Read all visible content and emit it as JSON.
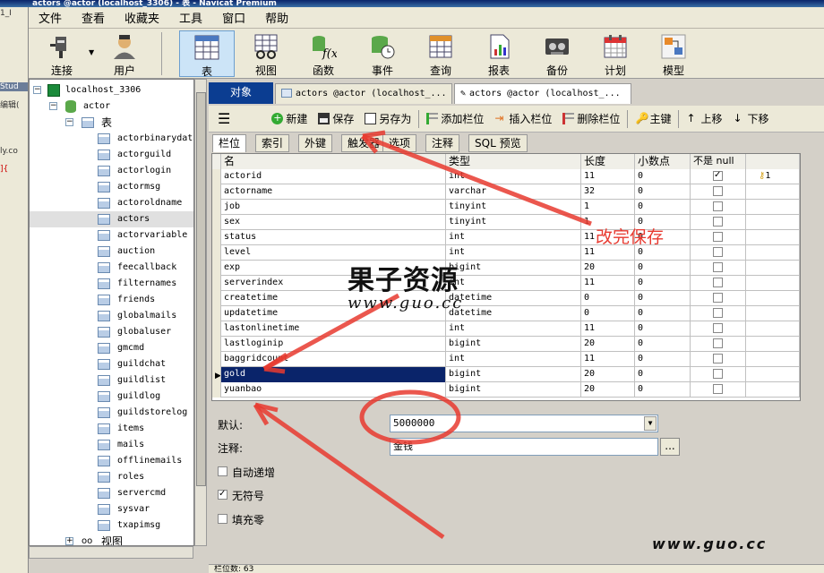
{
  "window": {
    "title": "actors @actor (localhost_3306) - 表 - Navicat Premium"
  },
  "left_strip": {
    "texts": [
      "1_I",
      "Stud",
      "编辑(",
      "ly.co",
      "]{"
    ]
  },
  "menu": [
    "文件",
    "查看",
    "收藏夹",
    "工具",
    "窗口",
    "帮助"
  ],
  "toolbar": [
    {
      "label": "连接",
      "icon": "plug-icon"
    },
    {
      "label": "用户",
      "icon": "user-icon"
    },
    {
      "label": "表",
      "icon": "table-icon"
    },
    {
      "label": "视图",
      "icon": "view-icon"
    },
    {
      "label": "函数",
      "icon": "function-icon"
    },
    {
      "label": "事件",
      "icon": "event-icon"
    },
    {
      "label": "查询",
      "icon": "query-icon"
    },
    {
      "label": "报表",
      "icon": "report-icon"
    },
    {
      "label": "备份",
      "icon": "backup-icon"
    },
    {
      "label": "计划",
      "icon": "schedule-icon"
    },
    {
      "label": "模型",
      "icon": "model-icon"
    }
  ],
  "tree": {
    "connection": "localhost_3306",
    "database": "actor",
    "tables_label": "表",
    "tables": [
      "actorbinarydata",
      "actorguild",
      "actorlogin",
      "actormsg",
      "actoroldname",
      "actors",
      "actorvariable",
      "auction",
      "feecallback",
      "filternames",
      "friends",
      "globalmails",
      "globaluser",
      "gmcmd",
      "guildchat",
      "guildlist",
      "guildlog",
      "guildstorelog",
      "items",
      "mails",
      "offlinemails",
      "roles",
      "servercmd",
      "sysvar",
      "txapimsg"
    ],
    "selected": "actors",
    "views_label": "视图"
  },
  "doc_tabs": [
    "对象",
    "actors @actor (localhost_...",
    "actors @actor (localhost_..."
  ],
  "edit_toolbar": {
    "new": "新建",
    "save": "保存",
    "save_as": "另存为",
    "add_field": "添加栏位",
    "insert_field": "插入栏位",
    "delete_field": "删除栏位",
    "primary_key": "主键",
    "move_up": "上移",
    "move_down": "下移"
  },
  "sub_tabs": [
    "栏位",
    "索引",
    "外键",
    "触发器",
    "选项",
    "注释",
    "SQL 预览"
  ],
  "grid": {
    "headers": [
      "名",
      "类型",
      "长度",
      "小数点",
      "不是 null",
      ""
    ],
    "rows": [
      {
        "name": "actorid",
        "type": "int",
        "length": "11",
        "decimals": "0",
        "not_null": true,
        "key": "1"
      },
      {
        "name": "actorname",
        "type": "varchar",
        "length": "32",
        "decimals": "0",
        "not_null": false,
        "key": ""
      },
      {
        "name": "job",
        "type": "tinyint",
        "length": "1",
        "decimals": "0",
        "not_null": false,
        "key": ""
      },
      {
        "name": "sex",
        "type": "tinyint",
        "length": "1",
        "decimals": "0",
        "not_null": false,
        "key": ""
      },
      {
        "name": "status",
        "type": "int",
        "length": "11",
        "decimals": "0",
        "not_null": false,
        "key": ""
      },
      {
        "name": "level",
        "type": "int",
        "length": "11",
        "decimals": "0",
        "not_null": false,
        "key": ""
      },
      {
        "name": "exp",
        "type": "bigint",
        "length": "20",
        "decimals": "0",
        "not_null": false,
        "key": ""
      },
      {
        "name": "serverindex",
        "type": "int",
        "length": "11",
        "decimals": "0",
        "not_null": false,
        "key": ""
      },
      {
        "name": "createtime",
        "type": "datetime",
        "length": "0",
        "decimals": "0",
        "not_null": false,
        "key": ""
      },
      {
        "name": "updatetime",
        "type": "datetime",
        "length": "0",
        "decimals": "0",
        "not_null": false,
        "key": ""
      },
      {
        "name": "lastonlinetime",
        "type": "int",
        "length": "11",
        "decimals": "0",
        "not_null": false,
        "key": ""
      },
      {
        "name": "lastloginip",
        "type": "bigint",
        "length": "20",
        "decimals": "0",
        "not_null": false,
        "key": ""
      },
      {
        "name": "baggridcount",
        "type": "int",
        "length": "11",
        "decimals": "0",
        "not_null": false,
        "key": ""
      },
      {
        "name": "gold",
        "type": "bigint",
        "length": "20",
        "decimals": "0",
        "not_null": false,
        "key": ""
      },
      {
        "name": "yuanbao",
        "type": "bigint",
        "length": "20",
        "decimals": "0",
        "not_null": false,
        "key": ""
      }
    ],
    "selected_row": 13
  },
  "props": {
    "default_label": "默认:",
    "default_value": "5000000",
    "comment_label": "注释:",
    "comment_value": "金钱",
    "auto_increment": "自动递增",
    "unsigned": "无符号",
    "zerofill": "填充零",
    "unsigned_checked": true
  },
  "status": {
    "text": "栏位数: 63"
  },
  "annotations": {
    "note": "改完保存",
    "watermark_title": "果子资源",
    "watermark_url": "www.guo.cc",
    "corner_url": "www.guo.cc"
  },
  "colors": {
    "arrow": "#e8392f",
    "selection": "#0a246a",
    "object_tab": "#0b3d91"
  }
}
